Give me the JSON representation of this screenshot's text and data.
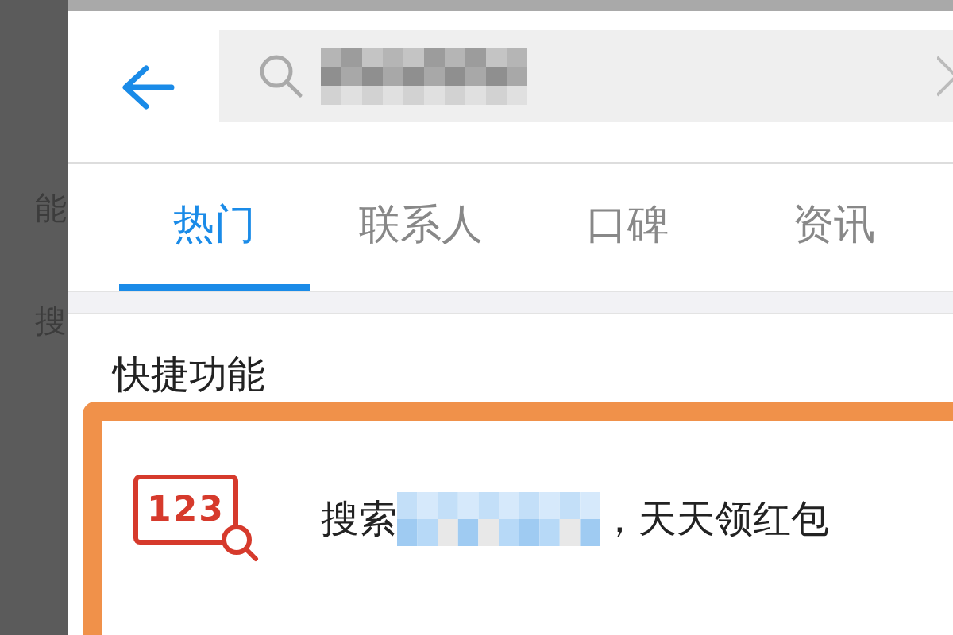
{
  "background_screen": {
    "texts": [
      "能",
      "搜"
    ]
  },
  "tabs": [
    {
      "label": "热门",
      "selected": true
    },
    {
      "label": "联系人",
      "selected": false
    },
    {
      "label": "口碑",
      "selected": false
    },
    {
      "label": "资讯",
      "selected": false
    }
  ],
  "section": {
    "title": "快捷功能"
  },
  "shortcut": {
    "icon_text": "123",
    "text_before": "搜索",
    "text_after": "，天天领红包"
  }
}
